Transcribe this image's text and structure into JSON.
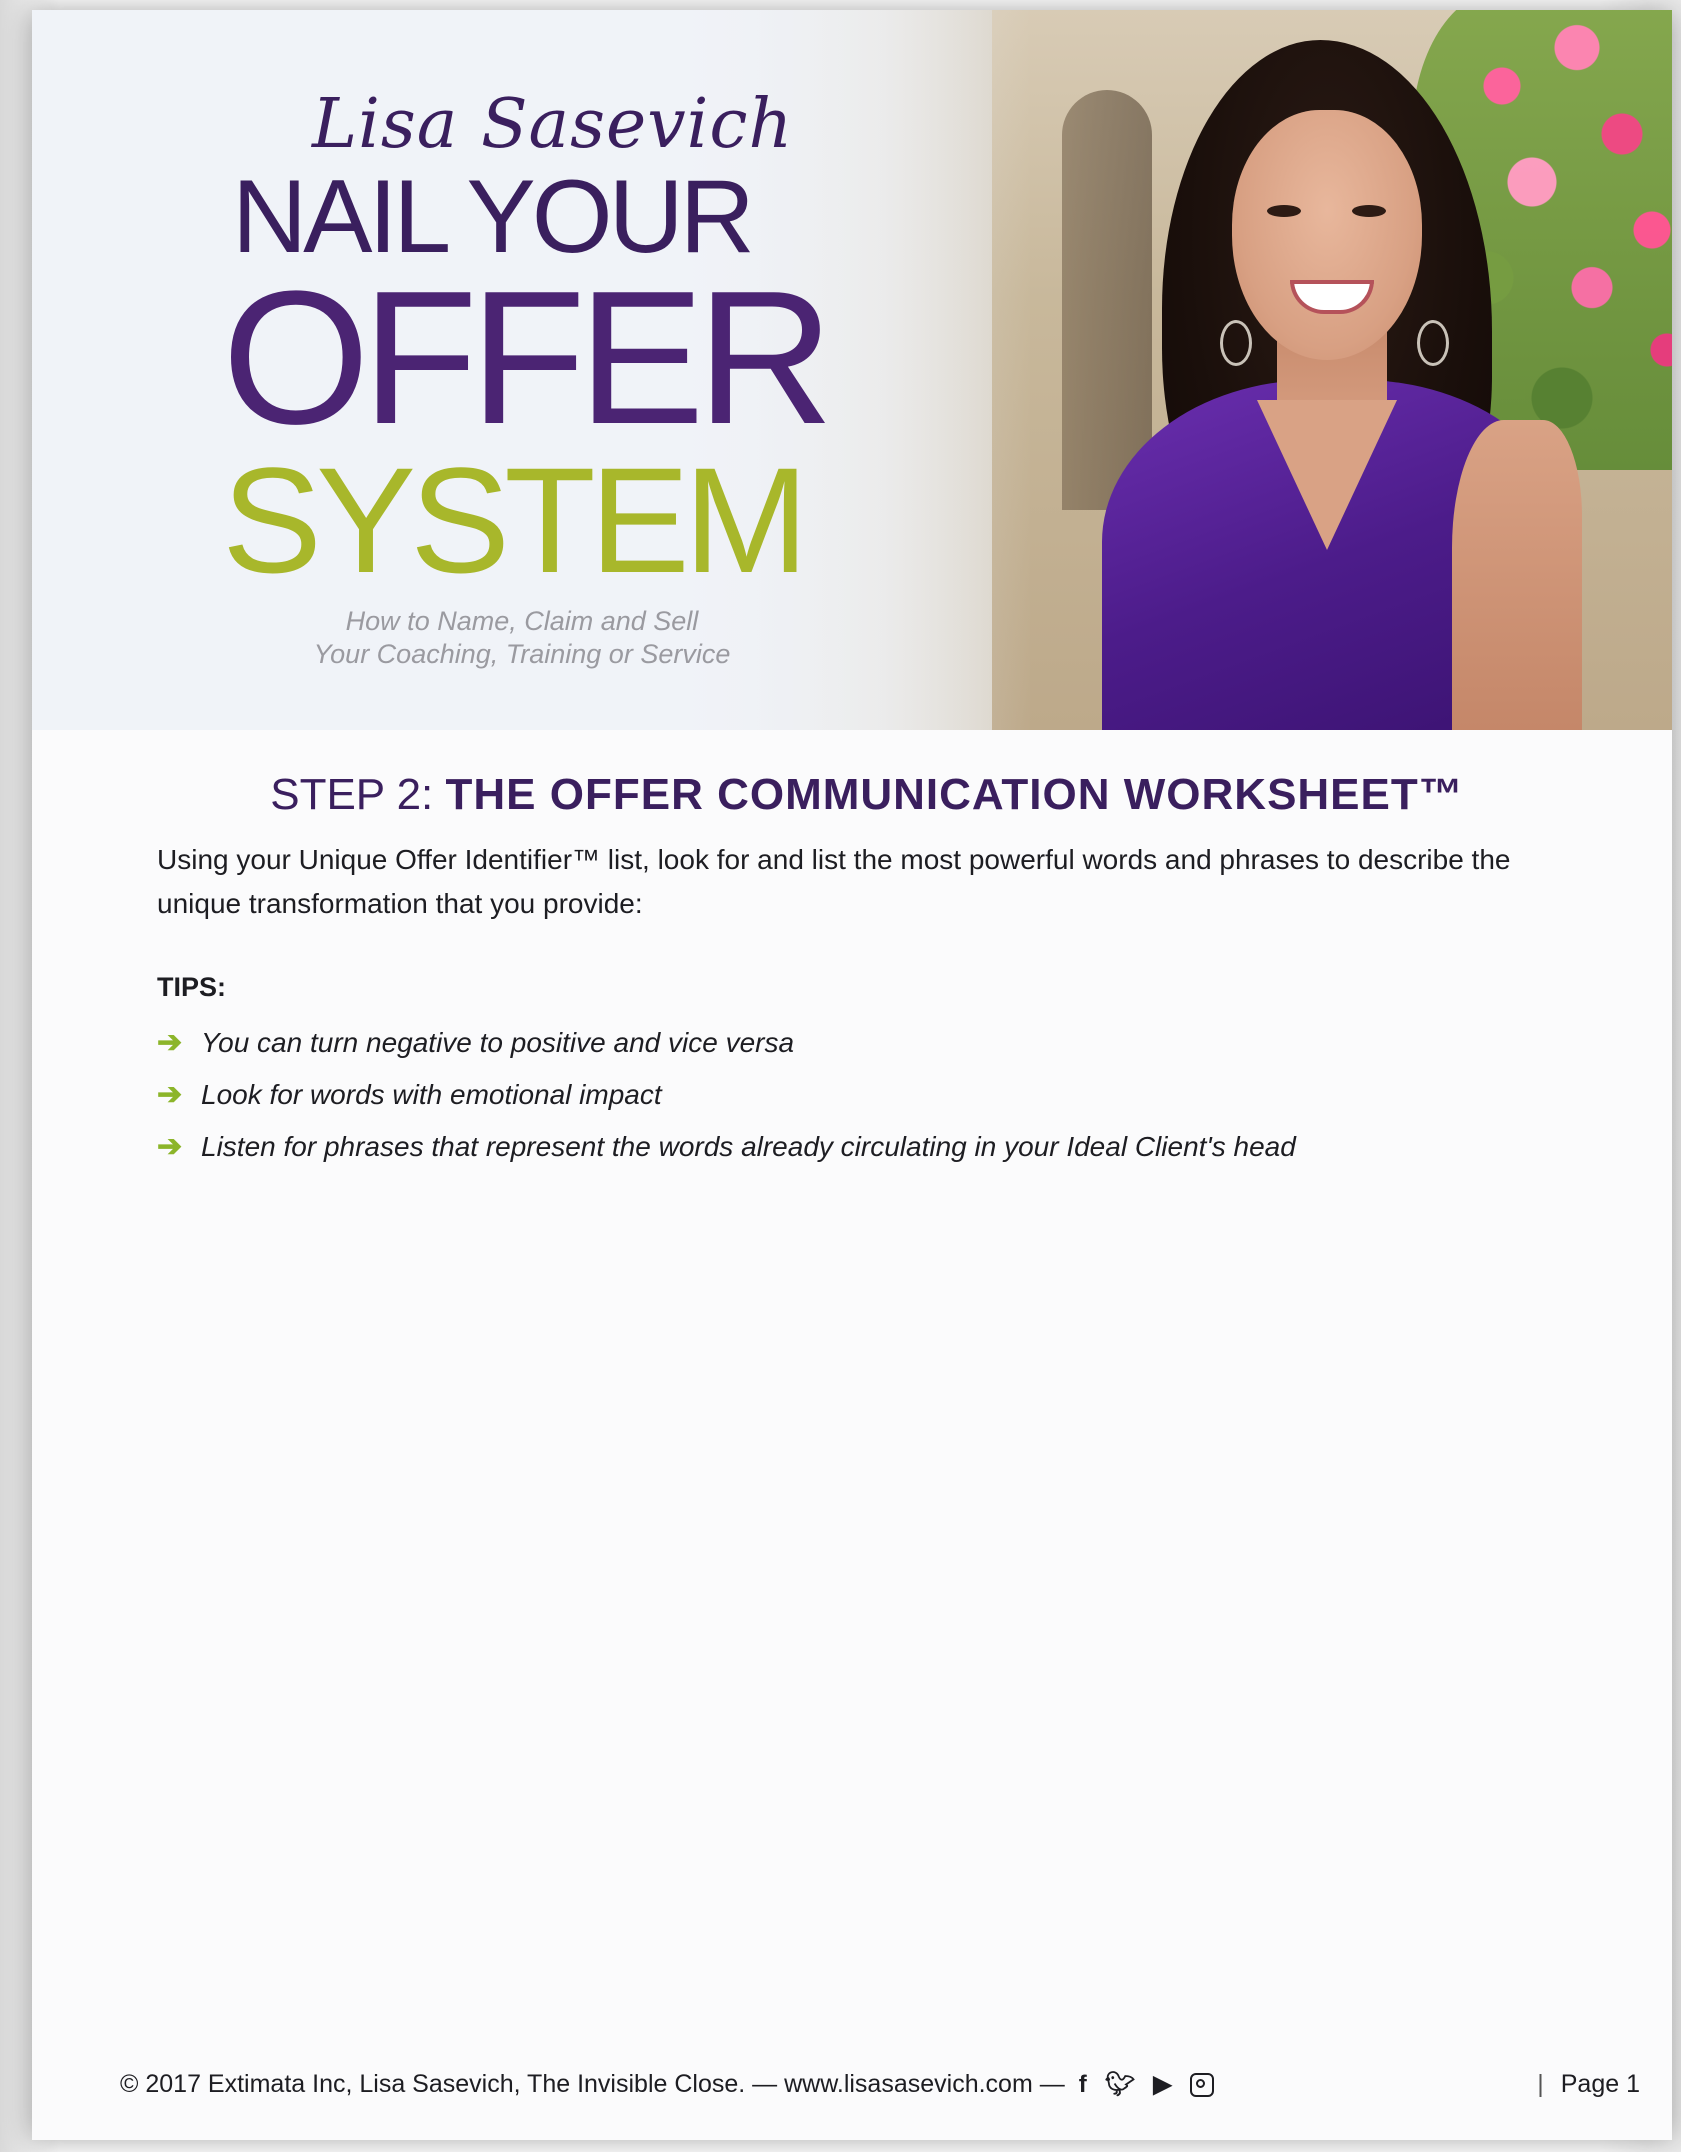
{
  "header": {
    "signature": "Lisa Sasevich",
    "logo_line1": "NAIL YOUR",
    "logo_line2": "OFFER",
    "logo_line3": "SYSTEM",
    "tagline_line1": "How to Name, Claim and Sell",
    "tagline_line2": "Your Coaching, Training or Service",
    "colors": {
      "purple": "#4b2473",
      "dark_purple": "#3a1f5e",
      "green": "#a8b72b"
    }
  },
  "worksheet": {
    "step": "STEP 2:",
    "title": "THE OFFER COMMUNICATION WORKSHEET™",
    "intro": "Using your Unique Offer Identifier™ list, look for and list the most powerful words and phrases to describe the unique transformation that you provide:",
    "tips_label": "TIPS:",
    "tip_icon": "arrow-right-icon",
    "tips": [
      "You can turn negative to positive and vice versa",
      "Look for words with emotional impact",
      "Listen for phrases that represent the words already circulating in your Ideal Client's head"
    ]
  },
  "footer": {
    "copyright": "© 2017 Extimata Inc, Lisa Sasevich, The Invisible Close. — www.lisasasevich.com —",
    "social_icons": [
      "facebook-icon",
      "twitter-icon",
      "youtube-icon",
      "instagram-icon"
    ],
    "page_separator": "|",
    "page_label": "Page 1"
  }
}
